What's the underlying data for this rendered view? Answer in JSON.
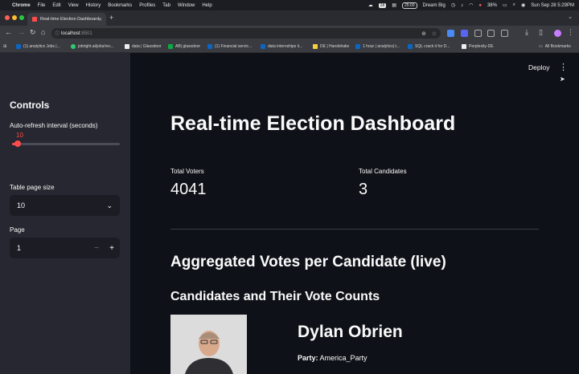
{
  "menubar": {
    "app": "Chrome",
    "items": [
      "File",
      "Edit",
      "View",
      "History",
      "Bookmarks",
      "Profiles",
      "Tab",
      "Window",
      "Help"
    ],
    "status": {
      "badge": "28",
      "timer": "25:00",
      "focus": "Dream Big",
      "battery": "38%",
      "clock": "Sun Sep 28  5:29PM"
    }
  },
  "browser": {
    "tab_title": "Real-time Election Dashboard",
    "url_host": "localhost",
    "url_port": ":8501",
    "bookmarks": [
      "(1) analytics Jobs |...",
      "jobright.ai/jobs/rec...",
      "data | Glassdoor",
      "AB| glassdoor",
      "(1) Financial servic...",
      "data internships li...",
      "DE | Handshake",
      "1 hour | analytics| t...",
      "SQL crack it for D...",
      "Perplexity-DE"
    ],
    "all_bookmarks": "All Bookmarks"
  },
  "app": {
    "deploy_label": "Deploy",
    "sidebar": {
      "title": "Controls",
      "refresh_label": "Auto-refresh interval (seconds)",
      "refresh_value": "10",
      "refresh_fraction": 0.05,
      "page_size_label": "Table page size",
      "page_size_value": "10",
      "page_label": "Page",
      "page_value": "1"
    },
    "title": "Real-time Election Dashboard",
    "metrics": [
      {
        "label": "Total Voters",
        "value": "4041"
      },
      {
        "label": "Total Candidates",
        "value": "3"
      }
    ],
    "section_title": "Aggregated Votes per Candidate (live)",
    "subsection_title": "Candidates and Their Vote Counts",
    "candidate": {
      "name": "Dylan Obrien",
      "party_label": "Party:",
      "party": "America_Party"
    }
  }
}
